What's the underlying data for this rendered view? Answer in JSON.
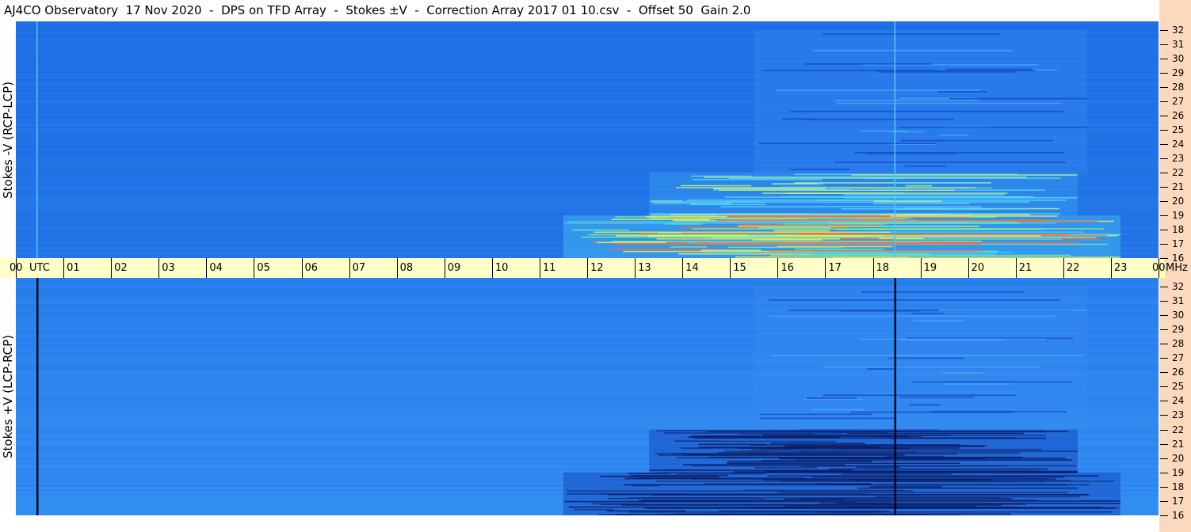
{
  "title": "AJ4CO Observatory  17 Nov 2020  -  DPS on TFD Array  -  Stokes ±V  -  Correction Array 2017 01 10.csv  -  Offset 50  Gain 2.0",
  "colors": {
    "background": "#1f6fe6",
    "time_axis_bg": "#ffffc8",
    "right_strip_bg": "#fcd9bd"
  },
  "chart_data": [
    {
      "type": "heatmap",
      "name_label": "Stokes -V (RCP-LCP)",
      "xlabel": "UTC",
      "ylabel": "MHz",
      "x_ticks": [
        "00",
        "01",
        "02",
        "03",
        "04",
        "05",
        "06",
        "07",
        "08",
        "09",
        "10",
        "11",
        "12",
        "13",
        "14",
        "15",
        "16",
        "17",
        "18",
        "19",
        "20",
        "21",
        "22",
        "23",
        "00"
      ],
      "y_ticks": [
        "16",
        "17",
        "18",
        "19",
        "20",
        "21",
        "22",
        "23",
        "24",
        "25",
        "26",
        "27",
        "28",
        "29",
        "30",
        "31",
        "32"
      ],
      "ylim": [
        16,
        32.6
      ],
      "xlim": [
        0,
        24
      ],
      "activity": [
        {
          "t_start": 11.5,
          "t_end": 23.2,
          "f_low": 16,
          "f_high": 19,
          "level": "high"
        },
        {
          "t_start": 13.3,
          "t_end": 22.3,
          "f_low": 19,
          "f_high": 22,
          "level": "medium"
        },
        {
          "t_start": 15.5,
          "t_end": 22.5,
          "f_low": 22,
          "f_high": 32,
          "level": "low"
        }
      ],
      "vertical_line_utc": 18.45
    },
    {
      "type": "heatmap",
      "name_label": "Stokes +V (LCP-RCP)",
      "xlabel": "UTC",
      "ylabel": "MHz",
      "x_ticks": [
        "00",
        "01",
        "02",
        "03",
        "04",
        "05",
        "06",
        "07",
        "08",
        "09",
        "10",
        "11",
        "12",
        "13",
        "14",
        "15",
        "16",
        "17",
        "18",
        "19",
        "20",
        "21",
        "22",
        "23",
        "00"
      ],
      "y_ticks": [
        "16",
        "17",
        "18",
        "19",
        "20",
        "21",
        "22",
        "23",
        "24",
        "25",
        "26",
        "27",
        "28",
        "29",
        "30",
        "31",
        "32"
      ],
      "ylim": [
        16,
        32.6
      ],
      "xlim": [
        0,
        24
      ],
      "activity": [
        {
          "t_start": 11.5,
          "t_end": 23.2,
          "f_low": 16,
          "f_high": 19,
          "level": "dark"
        },
        {
          "t_start": 13.3,
          "t_end": 22.3,
          "f_low": 19,
          "f_high": 22,
          "level": "dark"
        },
        {
          "t_start": 15.5,
          "t_end": 22.5,
          "f_low": 22,
          "f_high": 32,
          "level": "low"
        }
      ],
      "vertical_line_utc": 18.45
    }
  ],
  "time_axis": {
    "labels": [
      "00",
      "01",
      "02",
      "03",
      "04",
      "05",
      "06",
      "07",
      "08",
      "09",
      "10",
      "11",
      "12",
      "13",
      "14",
      "15",
      "16",
      "17",
      "18",
      "19",
      "20",
      "21",
      "22",
      "23",
      "00"
    ],
    "utc_label": "UTC",
    "mhz_label": "MHz"
  },
  "freq_labels": [
    "32",
    "31",
    "30",
    "29",
    "28",
    "27",
    "26",
    "25",
    "24",
    "23",
    "22",
    "21",
    "20",
    "19",
    "18",
    "17",
    "16"
  ]
}
